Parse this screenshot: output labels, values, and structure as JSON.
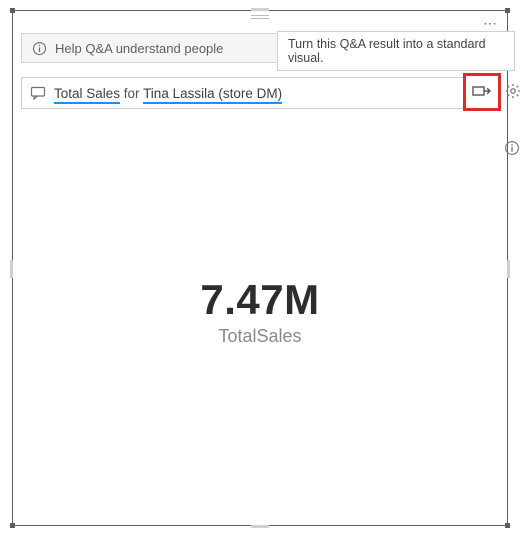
{
  "banner": {
    "text": "Help Q&A understand people"
  },
  "tooltip": {
    "text": "Turn this Q&A result into a standard visual."
  },
  "query": {
    "term1": "Total Sales",
    "mid": " for ",
    "term2": "Tina Lassila (store DM)"
  },
  "metric": {
    "value": "7.47M",
    "label": "TotalSales"
  },
  "menu": {
    "dots": "⋯"
  }
}
